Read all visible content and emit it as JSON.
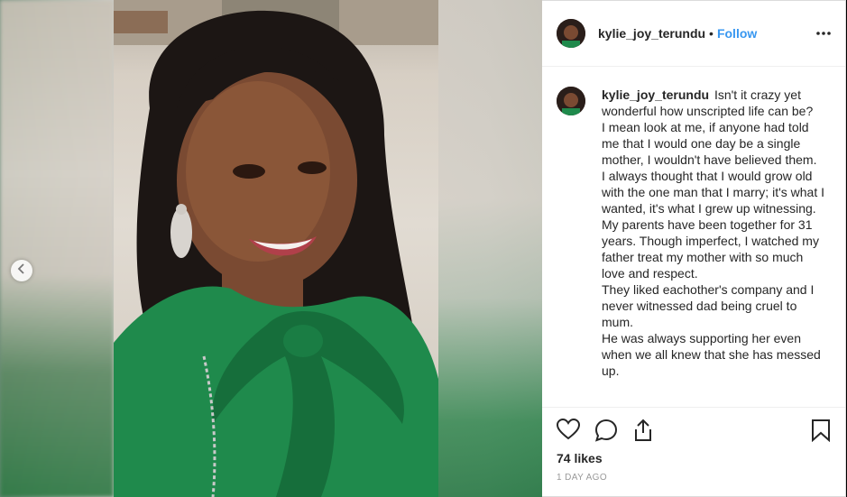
{
  "post": {
    "username": "kylie_joy_terundu",
    "separator": "•",
    "follow_label": "Follow",
    "caption_user": "kylie_joy_terundu",
    "caption_lines": [
      "Isn't it crazy yet wonderful how unscripted life can be?",
      "I mean look at me, if anyone had told me that I would one day be a single mother, I wouldn't have believed them.",
      "I always thought that I would grow old with the one man that I marry; it's what I wanted, it's what I grew up witnessing.",
      "My parents have been together for 31 years. Though imperfect, I watched my father treat my mother with so much love and respect.",
      "They liked eachother's company and I never witnessed dad being cruel to mum.",
      "He was always supporting her even when we all knew that she has messed up."
    ],
    "likes": "74 likes",
    "timestamp": "1 DAY AGO"
  },
  "icons": {
    "prev": "chevron-left-icon",
    "more": "more-options-icon",
    "like": "heart-icon",
    "comment": "comment-icon",
    "share": "share-icon",
    "save": "bookmark-icon"
  },
  "colors": {
    "link": "#3897f0",
    "text": "#262626",
    "muted": "#999999",
    "dress": "#1f8a4c"
  }
}
